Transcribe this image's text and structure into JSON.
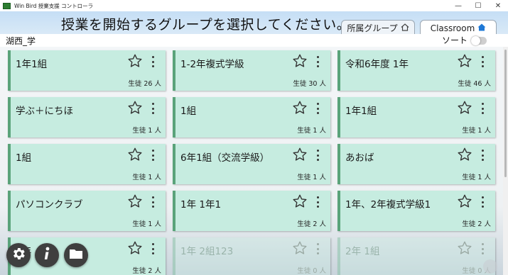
{
  "window": {
    "title": "Win Bird 授業支援 コントローラ",
    "controls": [
      "—",
      "☐",
      "✕"
    ]
  },
  "header": {
    "title": "授業を開始するグループを選択してください。",
    "tabs": [
      {
        "label": "所属グループ",
        "icon": "home-outline-icon"
      },
      {
        "label": "Classroom",
        "icon": "home-filled-icon",
        "active": true
      }
    ]
  },
  "subheader": {
    "school": "湖西_学",
    "sort_label": "ソート",
    "sort_on": false
  },
  "cards": [
    {
      "name": "1年1組",
      "count": "生徒 26 人"
    },
    {
      "name": "1-2年複式学級",
      "count": "生徒 30 人"
    },
    {
      "name": "令和6年度 1年",
      "count": "生徒 46 人"
    },
    {
      "name": "学ぶ＋にちほ",
      "count": "生徒 1 人"
    },
    {
      "name": "1組",
      "count": "生徒 1 人"
    },
    {
      "name": "1年1組",
      "count": "生徒 1 人"
    },
    {
      "name": "1組",
      "count": "生徒 1 人"
    },
    {
      "name": "6年1組（交流学級）",
      "count": "生徒 1 人"
    },
    {
      "name": "あおば",
      "count": "生徒 1 人"
    },
    {
      "name": "パソコンクラブ",
      "count": "生徒 1 人"
    },
    {
      "name": "1年 1年1",
      "count": "生徒 2 人"
    },
    {
      "name": "1年、2年複式学級1",
      "count": "生徒 2 人"
    },
    {
      "name": "1年",
      "count": "生徒 2 人"
    },
    {
      "name": "1年 2組123",
      "count": "生徒 0 人"
    },
    {
      "name": "2年 1組",
      "count": "生徒 0 人"
    }
  ],
  "colors": {
    "card_bg": "#c6ece0",
    "card_accent": "#5aa37a",
    "header_bg": "#c5def5",
    "fab_bg": "#3f3f3f"
  }
}
